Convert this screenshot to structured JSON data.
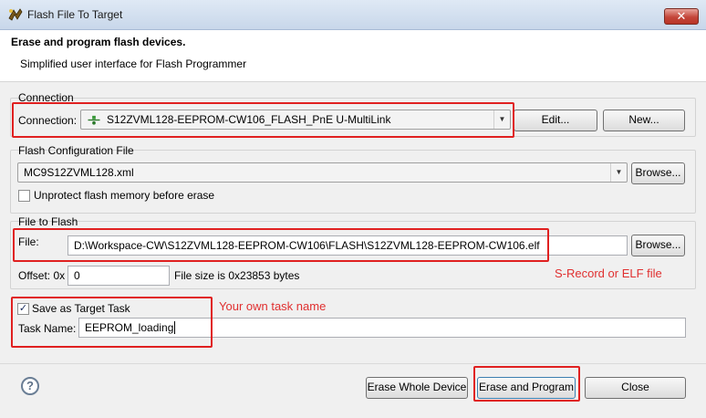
{
  "window": {
    "title": "Flash File To Target",
    "close_glyph": "✕"
  },
  "header": {
    "title": "Erase and program flash devices.",
    "description": "Simplified user interface for Flash Programmer"
  },
  "connection": {
    "group_label": "Connection",
    "label": "Connection:",
    "value": "S12ZVML128-EEPROM-CW106_FLASH_PnE U-MultiLink",
    "edit_label": "Edit...",
    "new_label": "New..."
  },
  "flash_config": {
    "group_label": "Flash Configuration File",
    "value": "MC9S12ZVML128.xml",
    "browse_label": "Browse...",
    "unprotect_label": "Unprotect flash memory before erase",
    "unprotect_checked": false
  },
  "file_to_flash": {
    "group_label": "File to Flash",
    "file_label": "File:",
    "file_value": "D:\\Workspace-CW\\S12ZVML128-EEPROM-CW106\\FLASH\\S12ZVML128-EEPROM-CW106.elf",
    "browse_label": "Browse...",
    "offset_label": "Offset: 0x",
    "offset_value": "0",
    "file_size_text": "File size is 0x23853 bytes"
  },
  "target_task": {
    "save_label": "Save as Target Task",
    "save_checked": true,
    "check_glyph": "✓",
    "task_name_label": "Task Name:",
    "task_name_value": "EEPROM_loading"
  },
  "annotations": {
    "srecord": "S-Record or ELF file",
    "task_name": "Your own task name"
  },
  "footer": {
    "help_glyph": "?",
    "erase_whole_label": "Erase Whole Device",
    "erase_program_label": "Erase and Program",
    "close_label": "Close"
  },
  "colors": {
    "annotation_red": "#e02020",
    "accent_blue": "#3c7fb1"
  }
}
